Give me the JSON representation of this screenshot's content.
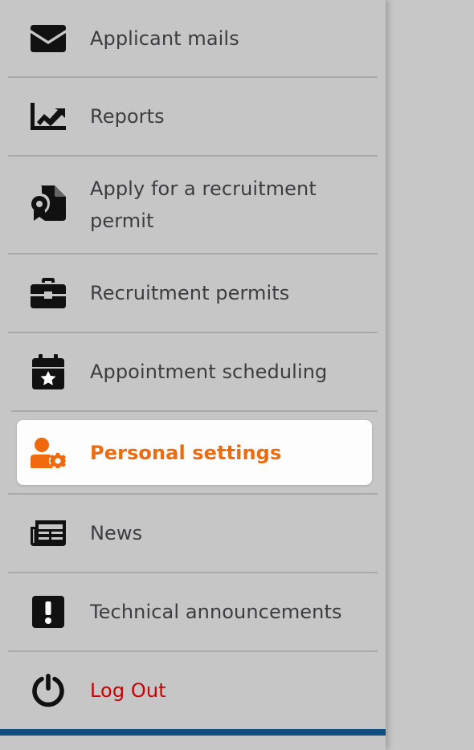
{
  "menu": {
    "items": [
      {
        "label": "Applicant mails",
        "icon": "envelope-icon"
      },
      {
        "label": "Reports",
        "icon": "chart-line-icon"
      },
      {
        "label": "Apply for a recruitment permit",
        "icon": "file-certificate-icon"
      },
      {
        "label": "Recruitment permits",
        "icon": "briefcase-icon"
      },
      {
        "label": "Appointment scheduling",
        "icon": "calendar-star-icon"
      },
      {
        "label": "Personal settings",
        "icon": "user-gear-icon",
        "active": true
      },
      {
        "label": "News",
        "icon": "newspaper-icon"
      },
      {
        "label": "Technical announcements",
        "icon": "exclamation-square-icon"
      },
      {
        "label": "Log Out",
        "icon": "power-icon"
      }
    ]
  },
  "colors": {
    "active_text": "#ee6a0c",
    "logout_text": "#cc0000",
    "bottom_bar": "#0e4e80",
    "menu_bg": "#c6c6c6"
  }
}
